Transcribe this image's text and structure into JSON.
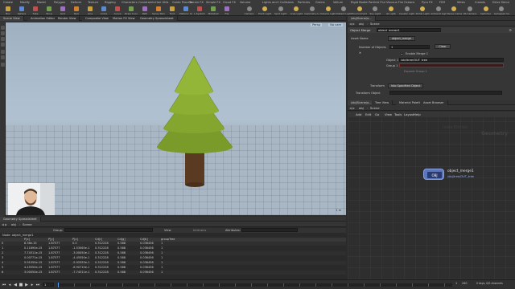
{
  "shelf": {
    "tabs": [
      "Create",
      "Modify",
      "Model",
      "Polygon",
      "Deform",
      "Texture",
      "Rigging",
      "Characters",
      "Constraints",
      "Hair Utils",
      "Guide Process",
      "Terrain FX",
      "Simple FX",
      "Cloud FX",
      "Volume"
    ],
    "right_tabs": [
      "Lights and Cameras",
      "Collisions",
      "Particles",
      "Grains",
      "Vellum",
      "Rigid Bodies",
      "Particle Fluids",
      "Viscous Fluids",
      "Oceans",
      "Pyro FX",
      "FEM",
      "Wires",
      "Crowds",
      "Drive Simulation"
    ],
    "tools": [
      "Box",
      "Sphere",
      "Tube",
      "Torus",
      "Grid",
      "Null",
      "Line",
      "Circle",
      "Curve",
      "Draw Curve",
      "Path",
      "Spray Paint",
      "Font",
      "Platonic Solids",
      "L-System",
      "Metaball",
      "File"
    ],
    "light_tools": [
      "Camera",
      "Point Light",
      "Spot Light",
      "Area Light",
      "Geometry Light",
      "Volume Light",
      "Distant Light",
      "Environment Light",
      "Sky Light",
      "GI Light",
      "Caustic Light",
      "Portal Light",
      "Ambient Light",
      "Stereo Camera",
      "VR Camera",
      "Switcher",
      "Gamepad Camera"
    ]
  },
  "viewer": {
    "tabs": [
      "Scene View",
      "Animation Editor",
      "Render View",
      "Composite View",
      "Motion FX View",
      "Geometry Spreadsheet"
    ],
    "path": [
      "obj",
      "Scene"
    ],
    "title": "View",
    "persp_label": "Persp",
    "cam_label": "No cam",
    "units": "1 m"
  },
  "sheet": {
    "tab": "Geometry Spreadsheet",
    "path": [
      "obj",
      "Scene"
    ],
    "node_label": "Node: object_merge1",
    "group_label": "Group:",
    "view_label": "View",
    "intrinsics_label": "Intrinsics",
    "attributes_label": "Attributes:",
    "headers": [
      "",
      "P[x]",
      "P[y]",
      "P[z]",
      "Cd[r]",
      "Cd[g]",
      "Cd[b]",
      "groupTree"
    ],
    "rows": [
      [
        "0",
        "8.36e-15",
        "1.87577",
        "0.0",
        "0.312228",
        "0.588",
        "0.036456",
        "1"
      ],
      [
        "1",
        "0.11690e-15",
        "1.87577",
        "-1.53065e-1",
        "0.312228",
        "0.588",
        "0.036456",
        "1"
      ],
      [
        "2",
        "7.74311e-15",
        "1.87577",
        "-3.00050e-1",
        "0.312228",
        "0.588",
        "0.036456",
        "1"
      ],
      [
        "3",
        "0.00771e-15",
        "1.87577",
        "-4.45550e-1",
        "0.312228",
        "0.588",
        "0.036456",
        "1"
      ],
      [
        "4",
        "5.91555e-15",
        "1.87577",
        "-5.92555e-1",
        "0.312228",
        "0.588",
        "0.036456",
        "1"
      ],
      [
        "5",
        "4.45550e-15",
        "1.87577",
        "-6.90710e-1",
        "0.312228",
        "0.588",
        "0.036456",
        "1"
      ],
      [
        "6",
        "3.00050e-15",
        "1.87577",
        "-7.74311e-1",
        "0.312228",
        "0.588",
        "0.036456",
        "1"
      ]
    ]
  },
  "timeline": {
    "frame": "1",
    "start": "1",
    "end": "240",
    "status": "0 keys, 0/0 channels"
  },
  "params": {
    "tab_path": [
      "obj",
      "Scene"
    ],
    "node_type": "Object Merge",
    "node_name": "object_merge1",
    "asset_name_label": "Asset Name",
    "asset_name_value": "object_merge",
    "num_objects_label": "Number of Objects",
    "num_objects_value": "1",
    "clear_label": "Clear",
    "enable_merge_label": "Enable Merge 1",
    "object1_label": "Object 1",
    "object1_value": "/obj/tree/OUT_tree",
    "group1_label": "Group 1",
    "expand_group_label": "Expand Group 1",
    "transform_label": "Transform",
    "transform_value": "Into Specified Object",
    "transform_object_label": "Transform Object"
  },
  "network": {
    "tabs": [
      "/obj/Scene/o...",
      "Tree View",
      "Material Palette",
      "Asset Browser"
    ],
    "path": [
      "obj",
      "Scene"
    ],
    "menu": [
      "Add",
      "Edit",
      "Go",
      "View",
      "Tools",
      "Layout",
      "Help"
    ],
    "watermark_top": "Indie Edition",
    "watermark_main": "Geometry",
    "node_name": "object_merge1",
    "node_comment": "/obj/tree/OUT_tree"
  },
  "colors": {
    "accent": "#f0a030",
    "tree_green": "#7a9a2a",
    "trunk_brown": "#5a3b22",
    "node_blue": "#5a78c0"
  }
}
